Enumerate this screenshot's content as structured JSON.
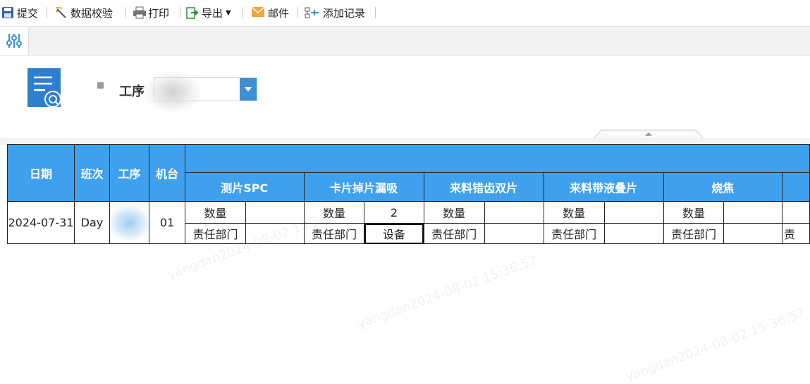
{
  "toolbar": {
    "submit": "提交",
    "validate": "数据校验",
    "print": "打印",
    "export": "导出",
    "mail": "邮件",
    "add_record": "添加记录"
  },
  "query": {
    "process_label": "工序",
    "process_value": ""
  },
  "table": {
    "headers": {
      "date": "日期",
      "shift": "班次",
      "process": "工序",
      "machine": "机台"
    },
    "groups": [
      "测片SPC",
      "卡片掉片漏吸",
      "来料错齿双片",
      "来料带液叠片",
      "烧焦"
    ],
    "qty_label": "数量",
    "dept_label": "责任部门",
    "row": {
      "date": "2024-07-31",
      "shift": "Day",
      "machine": "01",
      "qty_values": [
        "",
        "2",
        "",
        "",
        ""
      ],
      "dept_values": [
        "",
        "设备",
        "",
        "",
        ""
      ]
    },
    "overflow_dept_char": "责"
  },
  "watermark": "yangdan2024-08-02 15:36:57",
  "colors": {
    "header_blue": "#3fa0ee",
    "accent_blue": "#3d8fd6"
  }
}
